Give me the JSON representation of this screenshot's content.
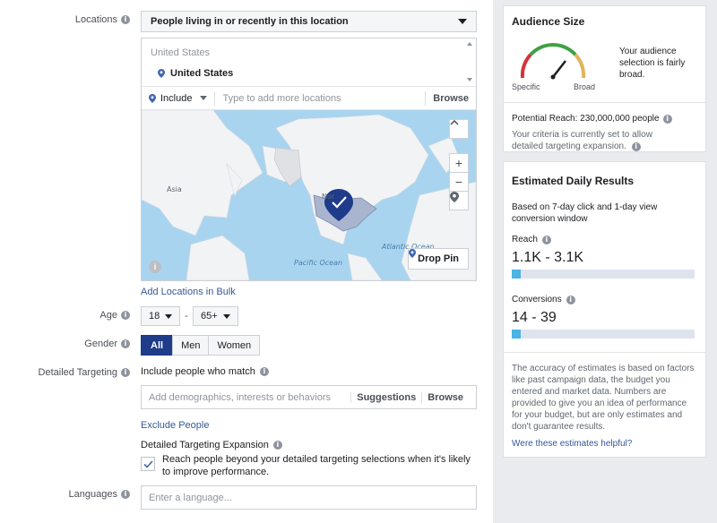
{
  "form": {
    "locations": {
      "label": "Locations",
      "mode": "People living in or recently in this location",
      "group": "United States",
      "selected": "United States",
      "include": "Include",
      "placeholder": "Type to add more locations",
      "browse": "Browse",
      "map": {
        "labels": {
          "asia": "Asia",
          "north": "Nor",
          "pacific": "Pacific Ocean",
          "atlantic": "Atlantic Ocean"
        },
        "zoom_in": "+",
        "zoom_out": "−",
        "collapse": "^",
        "drop_pin": "Drop Pin"
      },
      "bulk_link": "Add Locations in Bulk"
    },
    "age": {
      "label": "Age",
      "min": "18",
      "separator": "-",
      "max": "65+"
    },
    "gender": {
      "label": "Gender",
      "options": [
        "All",
        "Men",
        "Women"
      ],
      "selected": "All"
    },
    "detailed_targeting": {
      "label": "Detailed Targeting",
      "include_label": "Include people who match",
      "placeholder": "Add demographics, interests or behaviors",
      "suggestions": "Suggestions",
      "browse": "Browse",
      "exclude": "Exclude People"
    },
    "expansion": {
      "title": "Detailed Targeting Expansion",
      "checked": true,
      "text": "Reach people beyond your detailed targeting selections when it's likely to improve performance."
    },
    "languages": {
      "label": "Languages",
      "placeholder": "Enter a language..."
    }
  },
  "audience": {
    "title": "Audience Size",
    "gauge_specific": "Specific",
    "gauge_broad": "Broad",
    "description": "Your audience selection is fairly broad.",
    "potential_reach": "Potential Reach: 230,000,000 people",
    "criteria": "Your criteria is currently set to allow detailed targeting expansion."
  },
  "estimates": {
    "title": "Estimated Daily Results",
    "basis": "Based on 7-day click and 1-day view conversion window",
    "reach_label": "Reach",
    "reach_value": "1.1K - 3.1K",
    "reach_level": 0.05,
    "conversions_label": "Conversions",
    "conversions_value": "14 - 39",
    "conversions_level": 0.05,
    "disclaimer": "The accuracy of estimates is based on factors like past campaign data, the budget you entered and market data. Numbers are provided to give you an idea of performance for your budget, but are only estimates and don't guarantee results.",
    "helpful": "Were these estimates helpful?"
  },
  "colors": {
    "primary": "#1e3c8a",
    "link": "#365899",
    "bar_fill": "#4bb3e5",
    "bar_track": "#dfe3ee",
    "map_water": "#a8d4f0",
    "map_land": "#f2f3f5",
    "map_selected": "#a9b4cf"
  },
  "icons": [
    "info-icon",
    "caret-down-icon",
    "map-pin-icon",
    "checkmark-icon",
    "plus-icon",
    "minus-icon",
    "location-icon"
  ]
}
